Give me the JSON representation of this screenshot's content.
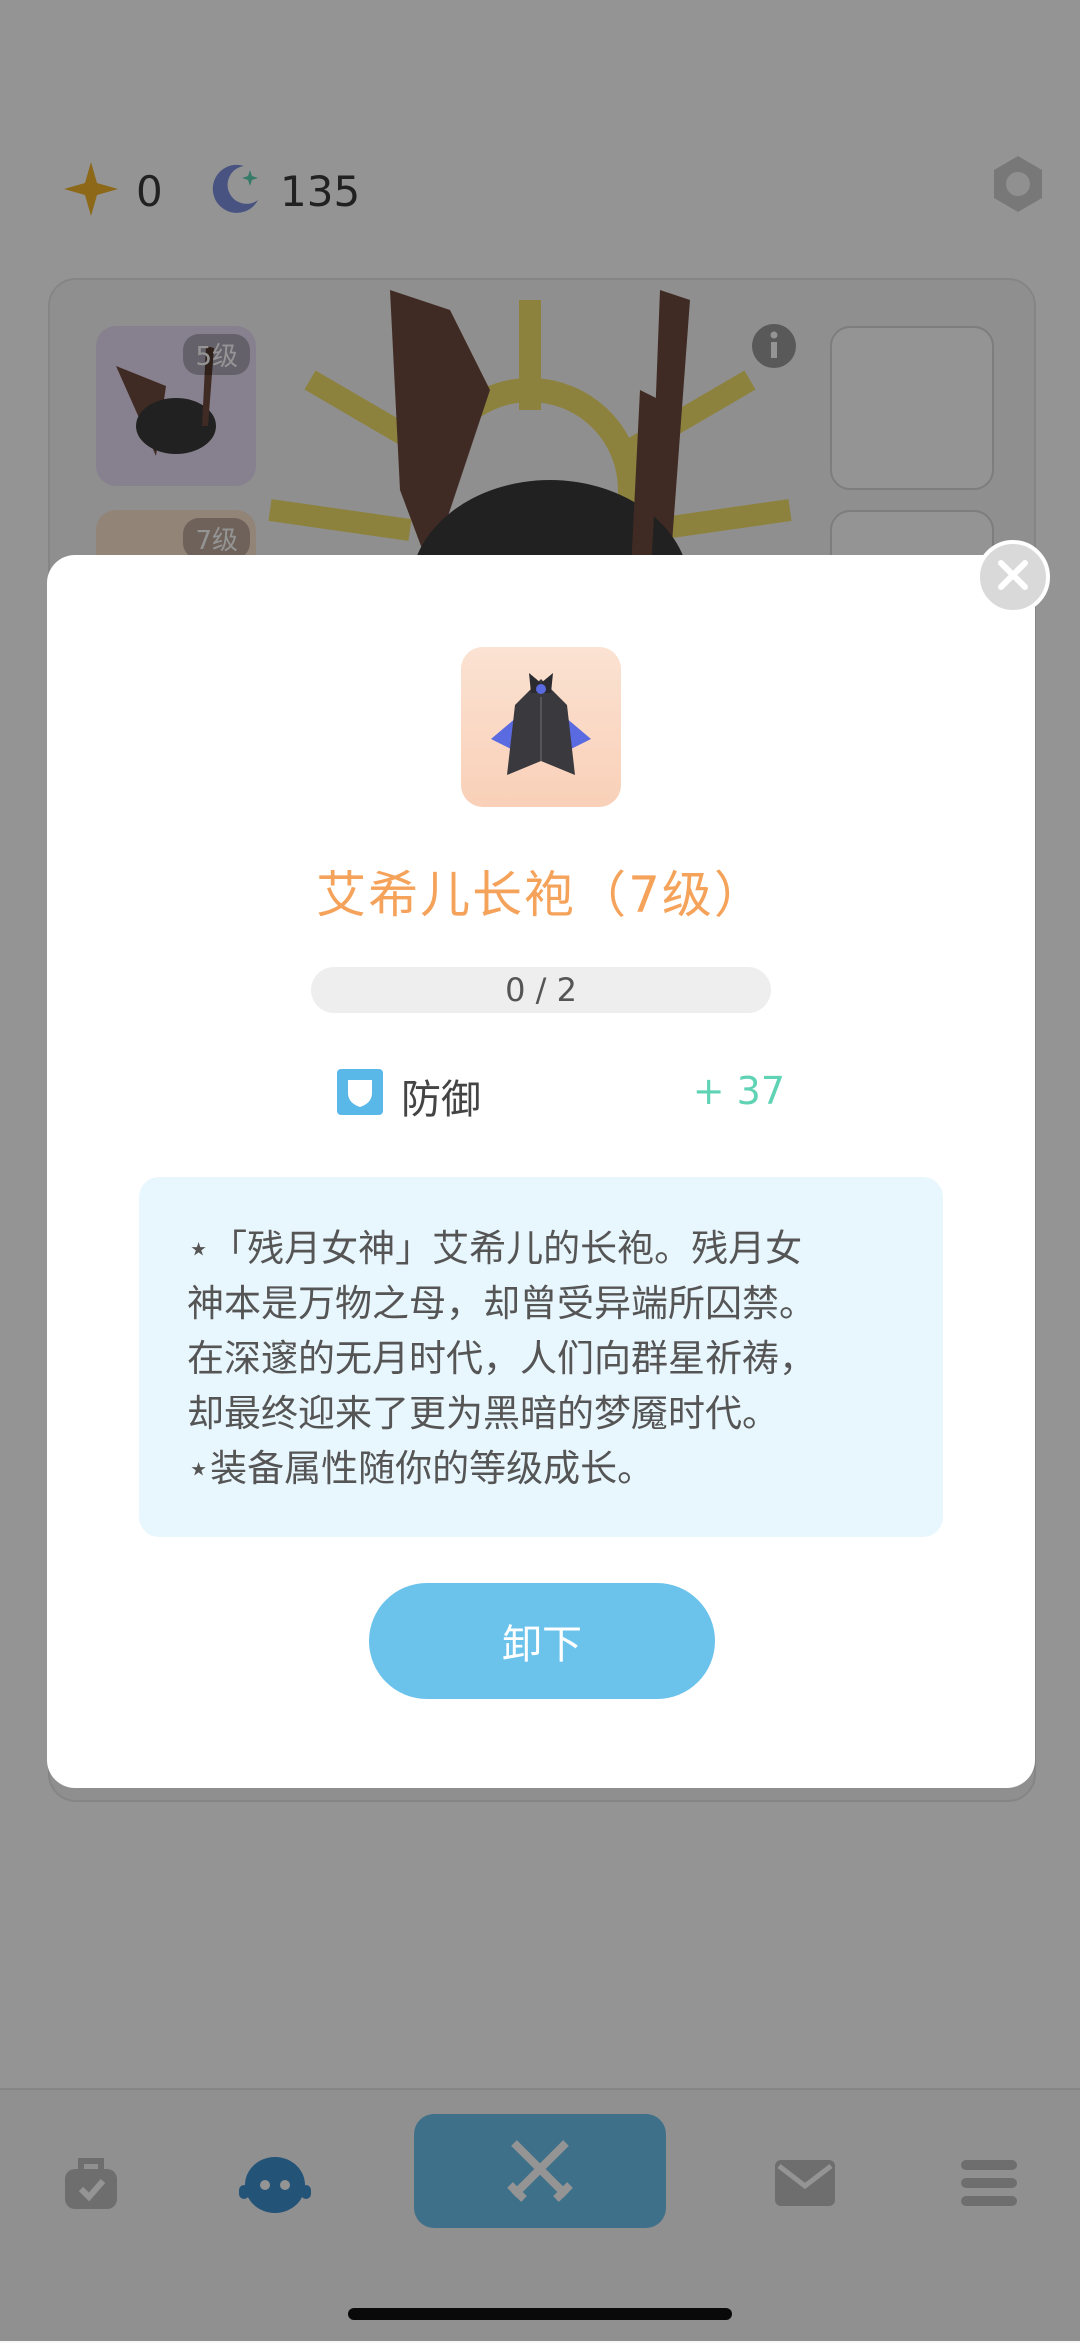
{
  "header": {
    "star_count": "0",
    "moon_count": "135"
  },
  "equipment": {
    "slots_left": [
      {
        "level": "5级"
      },
      {
        "level": "7级"
      }
    ]
  },
  "modal": {
    "item_name": "艾希儿长袍（7级）",
    "progress": "0 / 2",
    "stat": {
      "label": "防御",
      "value": "+ 37"
    },
    "description": [
      "⋆「残月女神」艾希儿的长袍。残月女",
      "神本是万物之母，却曾受异端所囚禁。",
      "在深邃的无月时代，人们向群星祈祷，",
      "却最终迎来了更为黑暗的梦魇时代。",
      "⋆装备属性随你的等级成长。"
    ],
    "action_label": "卸下"
  },
  "colors": {
    "accent_blue": "#6bc3ec",
    "title_orange": "#f5a25a",
    "stat_green": "#5fd3b4",
    "desc_bg": "#e8f6fd"
  },
  "icons": {
    "star": "star-icon",
    "moon": "moon-icon",
    "settings": "hexagon-settings-icon",
    "close": "close-icon",
    "shield": "shield-icon",
    "nav": [
      "bag-icon",
      "character-icon",
      "battle-swords-icon",
      "mail-icon",
      "menu-icon"
    ]
  }
}
